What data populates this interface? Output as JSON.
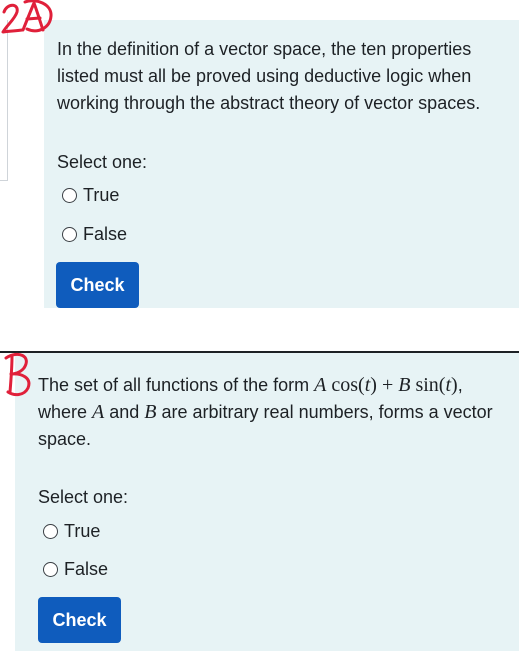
{
  "question1": {
    "annotation": "2A",
    "text": "In the definition of a vector space, the ten properties listed must all be proved using deductive logic when working through the abstract theory of vector spaces.",
    "prompt": "Select one:",
    "options": [
      "True",
      "False"
    ],
    "check_label": "Check"
  },
  "question2": {
    "annotation": "B",
    "text_parts": {
      "p1": "The set of all functions of the form ",
      "m1_A": "A",
      "m1_cos": "cos",
      "m1_t1": "t",
      "m1_plus": "+",
      "m1_B": "B",
      "m1_sin": "sin",
      "m1_t2": "t",
      "p2": ", where ",
      "m2_A": "A",
      "p3": " and ",
      "m3_B": "B",
      "p4": " are arbitrary real numbers, forms a vector space."
    },
    "prompt": "Select one:",
    "options": [
      "True",
      "False"
    ],
    "check_label": "Check"
  },
  "colors": {
    "card_bg": "#e7f3f5",
    "button_bg": "#0f5cbd",
    "annotation_red": "#e0203a",
    "text": "#1d2125"
  }
}
